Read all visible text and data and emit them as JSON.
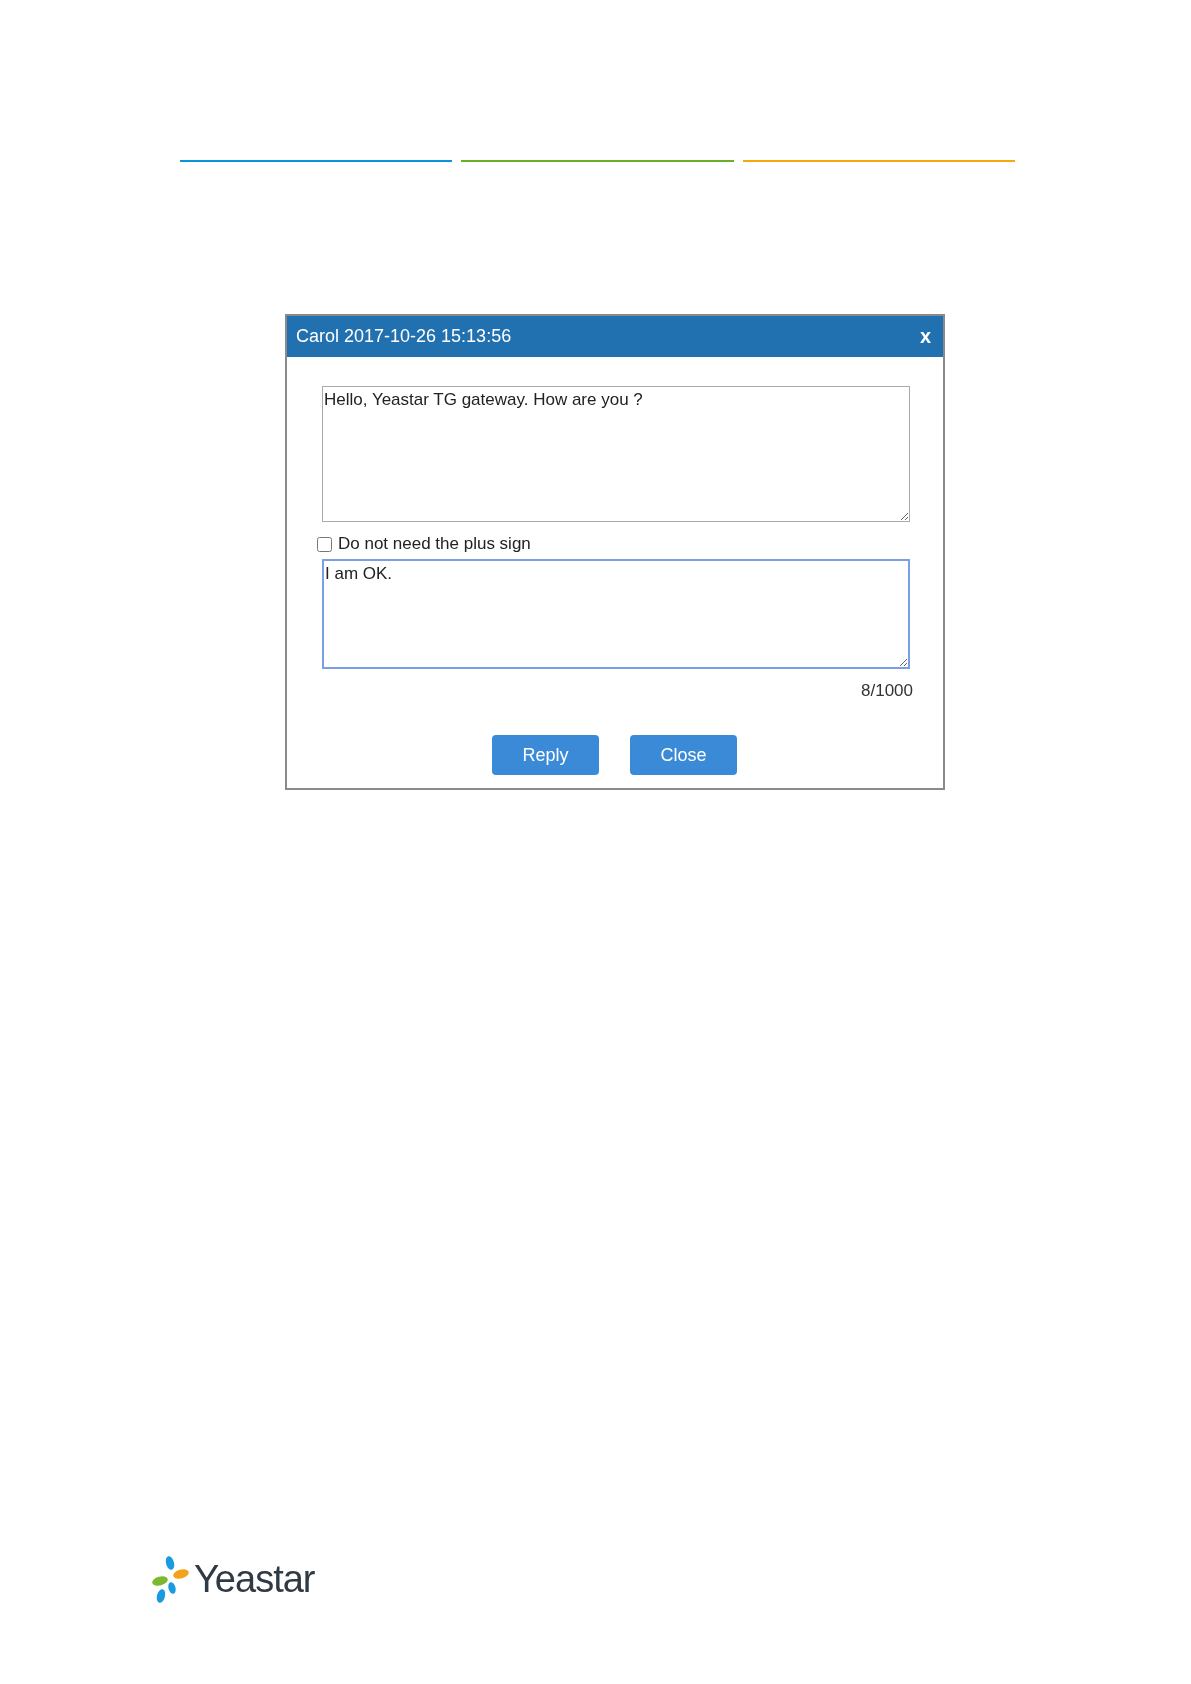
{
  "dialog": {
    "title": "Carol 2017-10-26 15:13:56",
    "close_label": "x",
    "message": {
      "value": "Hello, Yeastar TG gateway. How are you ?"
    },
    "option": {
      "label": "Do not need the plus sign",
      "checked": false
    },
    "reply": {
      "value": "I am OK.",
      "focused": true
    },
    "counter": "8/1000",
    "buttons": [
      "Reply",
      "Close"
    ]
  },
  "logo": {
    "text": "Yeastar"
  }
}
